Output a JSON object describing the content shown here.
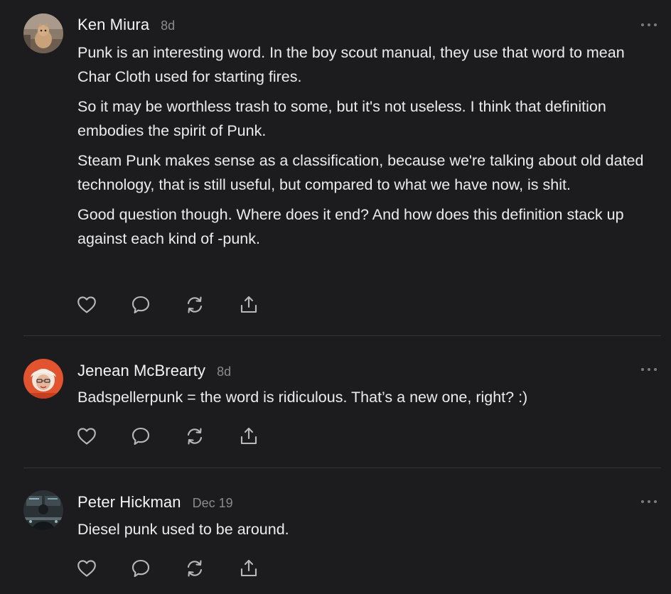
{
  "comments": [
    {
      "author": "Ken Miura",
      "time": "8d",
      "paragraphs": [
        "Punk is an interesting word. In the boy scout manual, they use that word to mean Char Cloth used for starting fires.",
        "So it may be worthless trash to some, but it's not useless. I think that definition embodies the spirit of Punk.",
        "Steam Punk makes sense as a classification, because we're talking about old dated technology, that is still useful, but compared to what we have now, is shit.",
        "Good question though. Where does it end? And how does this definition stack up against each kind of -punk."
      ],
      "actions": [
        "heart-icon",
        "comment-icon",
        "restack-icon",
        "share-icon"
      ]
    },
    {
      "author": "Jenean McBrearty",
      "time": "8d",
      "paragraphs": [
        "Badspellerpunk = the word is ridiculous. That’s a new one, right? :)"
      ],
      "actions": [
        "heart-icon",
        "comment-icon",
        "restack-icon",
        "share-icon"
      ]
    },
    {
      "author": "Peter Hickman",
      "time": "Dec 19",
      "paragraphs": [
        "Diesel punk used to be around."
      ],
      "actions": [
        "heart-icon",
        "comment-icon",
        "restack-icon",
        "share-icon"
      ]
    }
  ],
  "colors": {
    "background": "#1c1c1e",
    "text": "#ececec",
    "muted": "#8b8b8e",
    "icon": "#b9b9bc",
    "divider": "#343437"
  }
}
